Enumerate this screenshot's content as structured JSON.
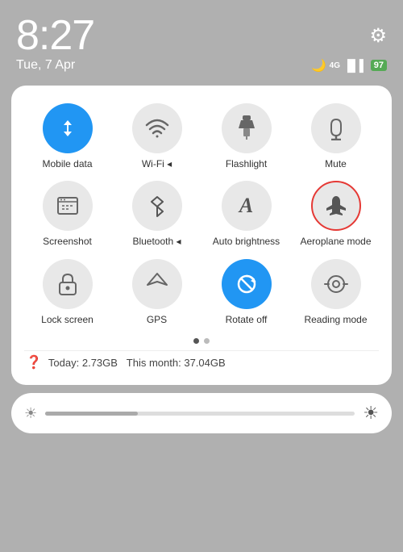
{
  "statusBar": {
    "time": "8:27",
    "date": "Tue, 7 Apr",
    "batteryPercent": "97",
    "settingsLabel": "settings"
  },
  "tiles": [
    {
      "id": "mobile-data",
      "label": "Mobile data",
      "icon": "⇅",
      "active": true
    },
    {
      "id": "wifi",
      "label": "Wi-Fi ◂",
      "icon": "wifi",
      "active": false
    },
    {
      "id": "flashlight",
      "label": "Flashlight",
      "icon": "flashlight",
      "active": false
    },
    {
      "id": "mute",
      "label": "Mute",
      "icon": "mute",
      "active": false
    },
    {
      "id": "screenshot",
      "label": "Screenshot",
      "icon": "screenshot",
      "active": false
    },
    {
      "id": "bluetooth",
      "label": "Bluetooth ◂",
      "icon": "bluetooth",
      "active": false
    },
    {
      "id": "auto-brightness",
      "label": "Auto brightness",
      "icon": "A",
      "active": false
    },
    {
      "id": "aeroplane",
      "label": "Aeroplane mode",
      "icon": "aeroplane",
      "active": false,
      "highlight": true
    },
    {
      "id": "lock-screen",
      "label": "Lock screen",
      "icon": "lock",
      "active": false
    },
    {
      "id": "gps",
      "label": "GPS",
      "icon": "gps",
      "active": false
    },
    {
      "id": "rotate-off",
      "label": "Rotate off",
      "icon": "rotate",
      "active": true
    },
    {
      "id": "reading-mode",
      "label": "Reading mode",
      "icon": "eye",
      "active": false
    }
  ],
  "pagination": {
    "dots": 2,
    "activeDot": 0
  },
  "dataUsage": {
    "icon": "?",
    "todayLabel": "Today:",
    "todayValue": "2.73GB",
    "monthLabel": "This month:",
    "monthValue": "37.04GB"
  },
  "brightnessBar": {
    "fillPercent": 30
  }
}
